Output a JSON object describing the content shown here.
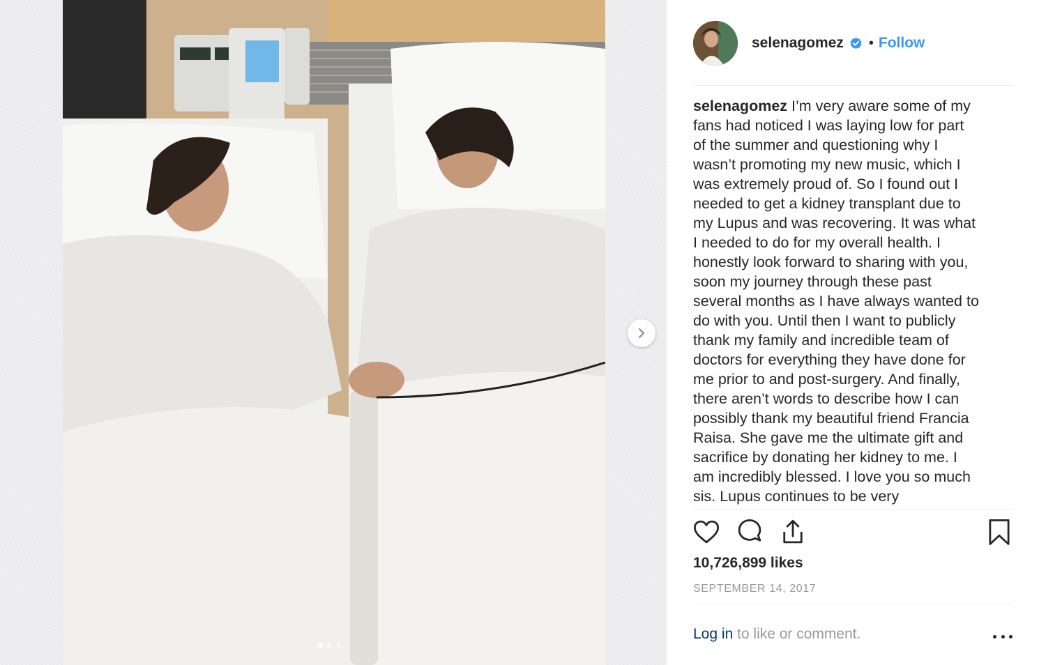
{
  "post": {
    "username": "selenagomez",
    "separator": "•",
    "follow_label": "Follow",
    "caption_author": "selenagomez",
    "caption_lines": [
      " I’m very aware some of my",
      "fans had noticed I was laying low for part",
      "of the summer and questioning why I",
      "wasn’t promoting my new music, which I",
      "was extremely proud of. So I found out I",
      "needed to get a kidney transplant due to",
      "my Lupus and was recovering. It was what",
      "I needed to do for my overall health. I",
      "honestly look forward to sharing with you,",
      "soon my journey through these past",
      "several months as I have always wanted to",
      "do with you. Until then I want to publicly",
      "thank my family and incredible team of",
      "doctors for everything they have done for",
      "me prior to and post-surgery. And finally,",
      "there aren’t words to describe how I can",
      "possibly thank my beautiful friend Francia",
      "Raisa. She gave me the ultimate gift and",
      "sacrifice by donating her kidney to me. I",
      "am incredibly blessed. I love you so much",
      "sis. Lupus continues to be very"
    ],
    "likes": "10,726,899 likes",
    "date": "SEPTEMBER 14, 2017",
    "login_link": "Log in",
    "login_rest": " to like or comment."
  },
  "carousel": {
    "total_slides": 3,
    "active_index": 0
  },
  "icons": {
    "like": "heart-icon",
    "comment": "comment-icon",
    "share": "share-icon",
    "save": "bookmark-icon",
    "verified": "verified-badge-icon",
    "next": "chevron-right-icon",
    "more": "more-options-icon"
  },
  "colors": {
    "link_blue": "#3897f0",
    "login_blue": "#003569",
    "verified_blue": "#3897f0",
    "muted": "#999999",
    "text": "#262626"
  }
}
